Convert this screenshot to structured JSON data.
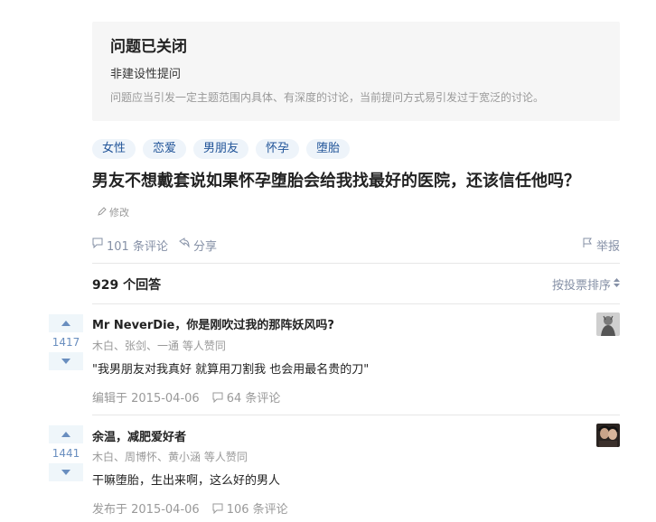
{
  "closed_notice": {
    "title": "问题已关闭",
    "reason": "非建设性提问",
    "description": "问题应当引发一定主题范围内具体、有深度的讨论，当前提问方式易引发过于宽泛的讨论。"
  },
  "tags": [
    "女性",
    "恋爱",
    "男朋友",
    "怀孕",
    "堕胎"
  ],
  "question": {
    "title": "男友不想戴套说如果怀孕堕胎会给我找最好的医院，还该信任他吗？",
    "edit_label": "修改",
    "comments_label": "101 条评论",
    "share_label": "分享",
    "report_label": "举报"
  },
  "answers_header": {
    "count_label": "929 个回答",
    "sort_label": "按投票排序"
  },
  "answers": [
    {
      "votes": "1417",
      "author": "Mr NeverDie，你是刚吹过我的那阵妖风吗?",
      "voters": "木白、张剑、一通 等人赞同",
      "content": "\"我男朋友对我真好 就算用刀割我 也会用最名贵的刀\"",
      "date_label": "编辑于 2015-04-06",
      "comments_label": "64 条评论"
    },
    {
      "votes": "1441",
      "author": "余温，减肥爱好者",
      "voters": "木白、周博怀、黄小涵 等人赞同",
      "content": "干嘛堕胎，生出来啊，这么好的男人",
      "date_label": "发布于 2015-04-06",
      "comments_label": "106 条评论"
    }
  ],
  "colors": {
    "accent": "#698ebf",
    "tag_bg": "#eef4fa",
    "tag_text": "#225599",
    "muted": "#8590a6"
  }
}
